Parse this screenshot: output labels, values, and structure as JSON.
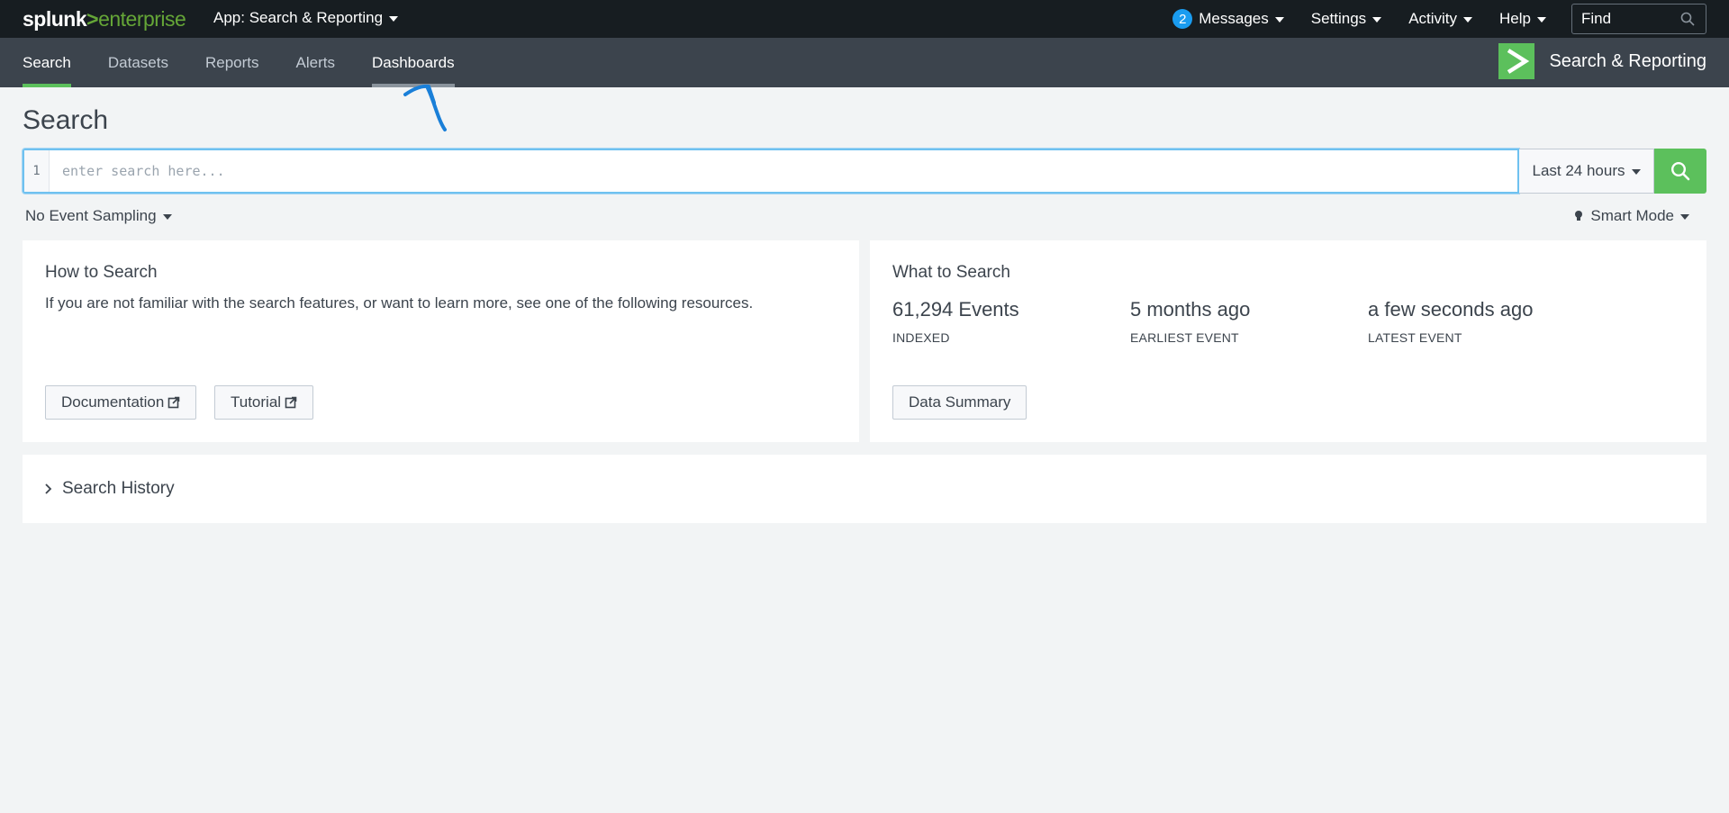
{
  "topbar": {
    "logo_splunk": "splunk",
    "logo_gt": ">",
    "logo_enterprise": "enterprise",
    "app_menu": "App: Search & Reporting",
    "messages_count": "2",
    "messages": "Messages",
    "settings": "Settings",
    "activity": "Activity",
    "help": "Help",
    "find_placeholder": "Find"
  },
  "appbar": {
    "nav": [
      "Search",
      "Datasets",
      "Reports",
      "Alerts",
      "Dashboards"
    ],
    "app_title": "Search & Reporting"
  },
  "page": {
    "title": "Search",
    "search_line_number": "1",
    "search_placeholder": "enter search here...",
    "time_range": "Last 24 hours",
    "sampling": "No Event Sampling",
    "mode": "Smart Mode"
  },
  "how_to_search": {
    "title": "How to Search",
    "description": "If you are not familiar with the search features, or want to learn more, see one of the following resources.",
    "documentation": "Documentation",
    "tutorial": "Tutorial"
  },
  "what_to_search": {
    "title": "What to Search",
    "stats": [
      {
        "value": "61,294 Events",
        "label": "INDEXED"
      },
      {
        "value": "5 months ago",
        "label": "EARLIEST EVENT"
      },
      {
        "value": "a few seconds ago",
        "label": "LATEST EVENT"
      }
    ],
    "data_summary": "Data Summary"
  },
  "history": {
    "title": "Search History"
  },
  "colors": {
    "topbar_bg": "#171d21",
    "appbar_bg": "#3c444d",
    "accent_green": "#5cc05c",
    "badge_blue": "#1a9cf0",
    "annotation_blue": "#1a7fd8"
  }
}
